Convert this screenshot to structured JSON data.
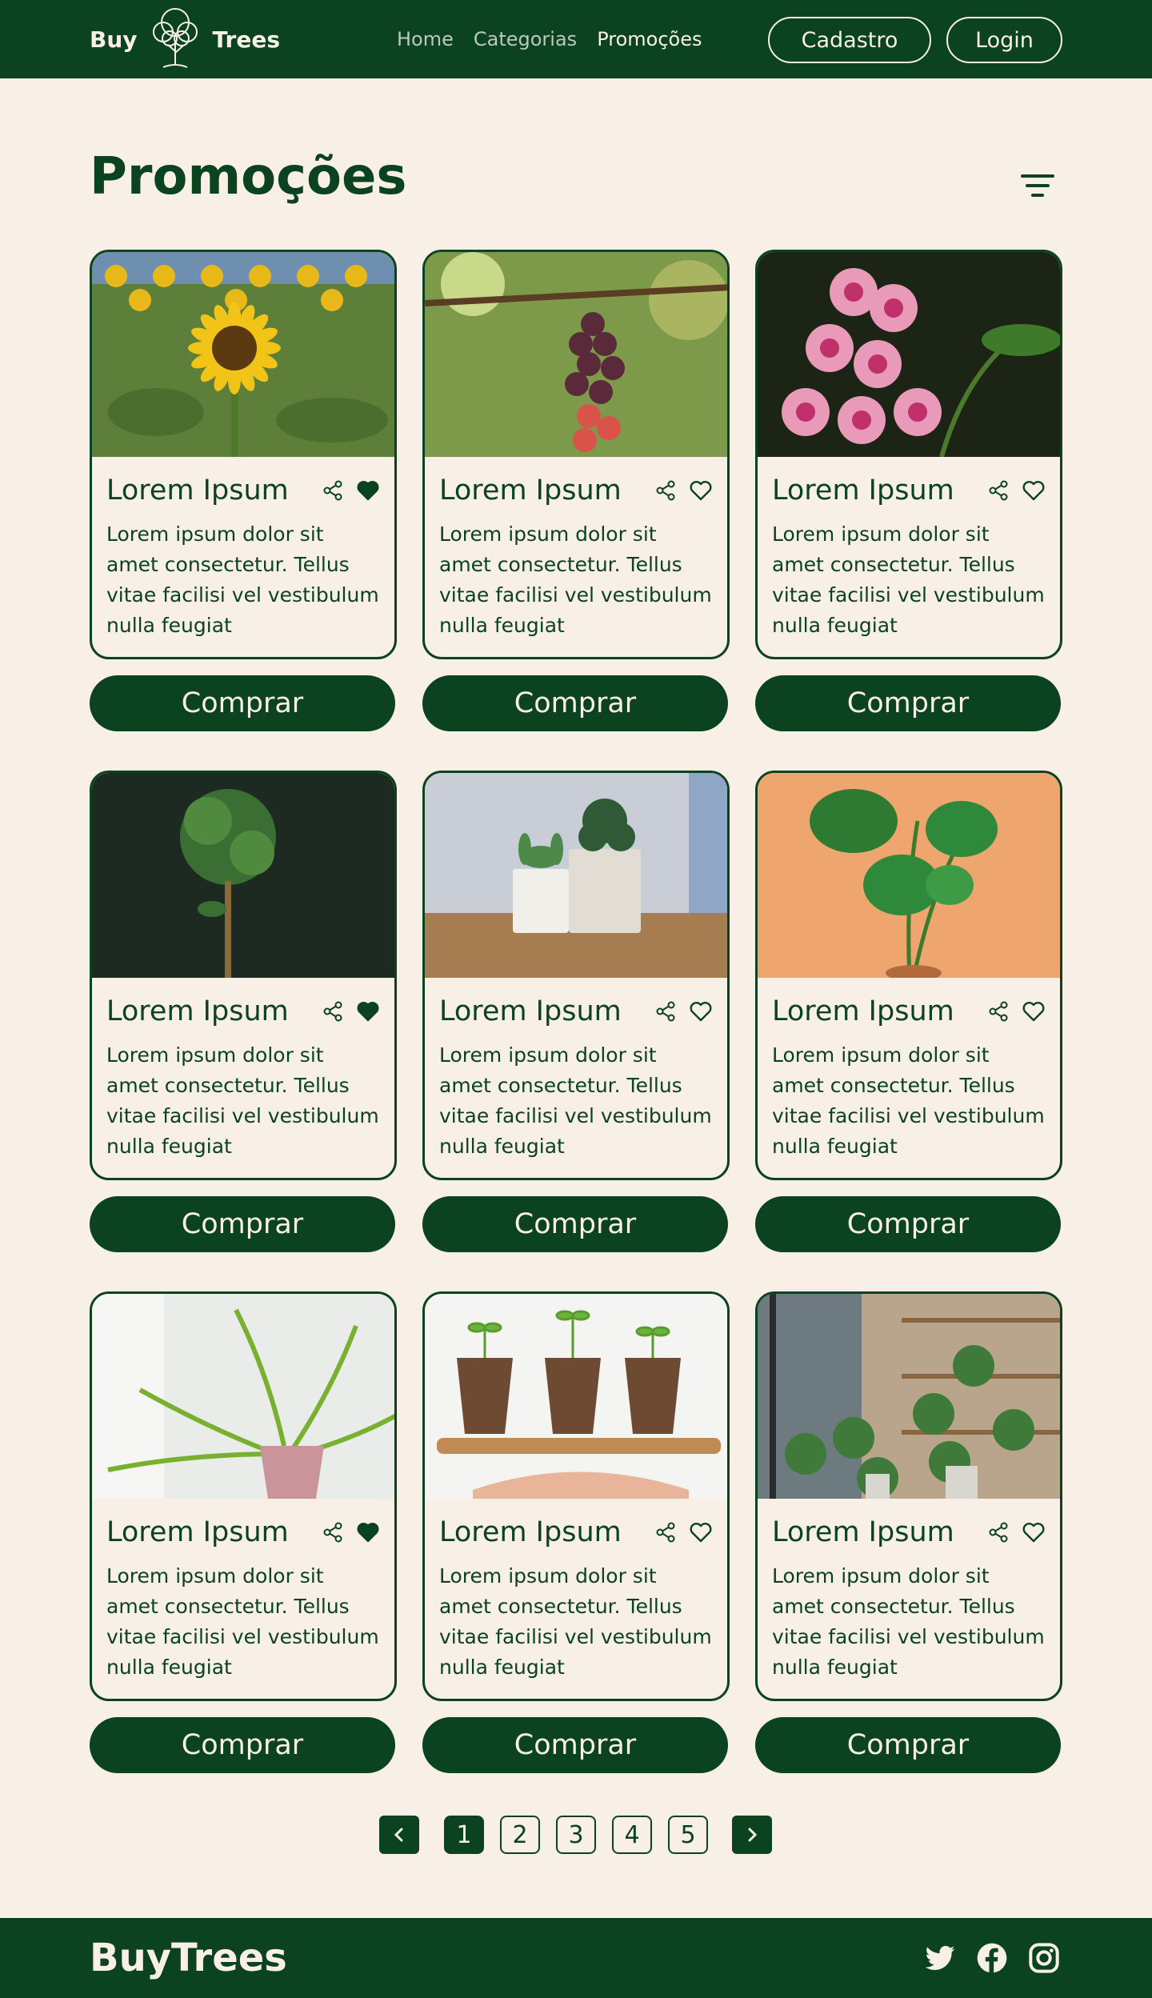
{
  "header": {
    "logo_left": "Buy",
    "logo_right": "Trees",
    "nav": [
      {
        "label": "Home",
        "active": false
      },
      {
        "label": "Categorias",
        "active": false
      },
      {
        "label": "Promoções",
        "active": true
      }
    ],
    "signup_label": "Cadastro",
    "login_label": "Login"
  },
  "page": {
    "title": "Promoções",
    "filter_icon": "filter-icon"
  },
  "products": [
    {
      "title": "Lorem Ipsum",
      "description": "Lorem ipsum dolor sit amet consectetur. Tellus vitae facilisi vel vestibulum nulla feugiat",
      "favorited": true,
      "image": "sunflower",
      "buy_label": "Comprar"
    },
    {
      "title": "Lorem Ipsum",
      "description": "Lorem ipsum dolor sit amet consectetur. Tellus vitae facilisi vel vestibulum nulla feugiat",
      "favorited": false,
      "image": "berries",
      "buy_label": "Comprar"
    },
    {
      "title": "Lorem Ipsum",
      "description": "Lorem ipsum dolor sit amet consectetur. Tellus vitae facilisi vel vestibulum nulla feugiat",
      "favorited": false,
      "image": "orchid",
      "buy_label": "Comprar"
    },
    {
      "title": "Lorem Ipsum",
      "description": "Lorem ipsum dolor sit amet consectetur. Tellus vitae facilisi vel vestibulum nulla feugiat",
      "favorited": true,
      "image": "topiary",
      "buy_label": "Comprar"
    },
    {
      "title": "Lorem Ipsum",
      "description": "Lorem ipsum dolor sit amet consectetur. Tellus vitae facilisi vel vestibulum nulla feugiat",
      "favorited": false,
      "image": "succulents",
      "buy_label": "Comprar"
    },
    {
      "title": "Lorem Ipsum",
      "description": "Lorem ipsum dolor sit amet consectetur. Tellus vitae facilisi vel vestibulum nulla feugiat",
      "favorited": false,
      "image": "monstera",
      "buy_label": "Comprar"
    },
    {
      "title": "Lorem Ipsum",
      "description": "Lorem ipsum dolor sit amet consectetur. Tellus vitae facilisi vel vestibulum nulla feugiat",
      "favorited": true,
      "image": "fern",
      "buy_label": "Comprar"
    },
    {
      "title": "Lorem Ipsum",
      "description": "Lorem ipsum dolor sit amet consectetur. Tellus vitae facilisi vel vestibulum nulla feugiat",
      "favorited": false,
      "image": "seedlings",
      "buy_label": "Comprar"
    },
    {
      "title": "Lorem Ipsum",
      "description": "Lorem ipsum dolor sit amet consectetur. Tellus vitae facilisi vel vestibulum nulla feugiat",
      "favorited": false,
      "image": "cafe-plants",
      "buy_label": "Comprar"
    }
  ],
  "pagination": {
    "pages": [
      "1",
      "2",
      "3",
      "4",
      "5"
    ],
    "current": "1"
  },
  "footer": {
    "brand": "BuyTrees",
    "social": [
      "twitter-icon",
      "facebook-icon",
      "instagram-icon"
    ]
  },
  "colors": {
    "primary": "#0b4220",
    "background": "#f8f0e6"
  }
}
